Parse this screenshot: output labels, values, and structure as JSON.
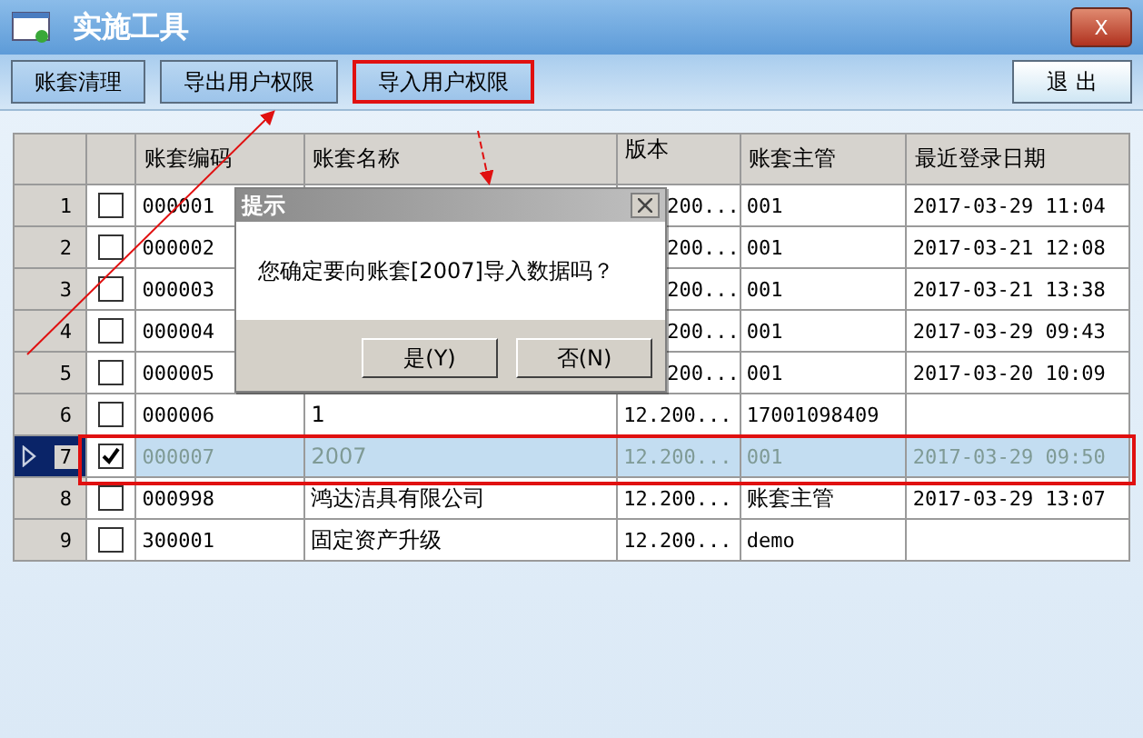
{
  "window": {
    "title": "实施工具",
    "close": "X"
  },
  "toolbar": [
    {
      "label": "账套清理",
      "highlighted": false
    },
    {
      "label": "导出用户权限",
      "highlighted": false
    },
    {
      "label": "导入用户权限",
      "highlighted": true
    }
  ],
  "exit_button": "退  出",
  "table": {
    "columns": [
      "账套编码",
      "账套名称",
      "版本",
      "账套主管",
      "最近登录日期"
    ],
    "rows": [
      {
        "number": "1",
        "checked": false,
        "selected": false,
        "highlighted": false,
        "cells": [
          "000001",
          "",
          "200...",
          "001",
          "2017-03-29 11:04"
        ]
      },
      {
        "number": "2",
        "checked": false,
        "selected": false,
        "highlighted": false,
        "cells": [
          "000002",
          "",
          "200...",
          "001",
          "2017-03-21 12:08"
        ]
      },
      {
        "number": "3",
        "checked": false,
        "selected": false,
        "highlighted": false,
        "cells": [
          "000003",
          "",
          "200...",
          "001",
          "2017-03-21 13:38"
        ]
      },
      {
        "number": "4",
        "checked": false,
        "selected": false,
        "highlighted": false,
        "cells": [
          "000004",
          "",
          "200...",
          "001",
          "2017-03-29 09:43"
        ]
      },
      {
        "number": "5",
        "checked": false,
        "selected": false,
        "highlighted": false,
        "cells": [
          "000005",
          "",
          "200...",
          "001",
          "2017-03-20 10:09"
        ]
      },
      {
        "number": "6",
        "checked": false,
        "selected": false,
        "highlighted": false,
        "cells": [
          "000006",
          "1",
          "12.200...",
          "17001098409",
          ""
        ]
      },
      {
        "number": "7",
        "checked": true,
        "selected": true,
        "highlighted": true,
        "cells": [
          "000007",
          "2007",
          "12.200...",
          "001",
          "2017-03-29 09:50"
        ]
      },
      {
        "number": "8",
        "checked": false,
        "selected": false,
        "highlighted": false,
        "cells": [
          "000998",
          "鸿达洁具有限公司",
          "12.200...",
          "账套主管",
          "2017-03-29 13:07"
        ]
      },
      {
        "number": "9",
        "checked": false,
        "selected": false,
        "highlighted": false,
        "cells": [
          "300001",
          "固定资产升级",
          "12.200...",
          "demo",
          ""
        ]
      }
    ]
  },
  "dialog": {
    "title": "提示",
    "message": "您确定要向账套[2007]导入数据吗？",
    "buttons": [
      "是(Y)",
      "否(N)"
    ]
  }
}
